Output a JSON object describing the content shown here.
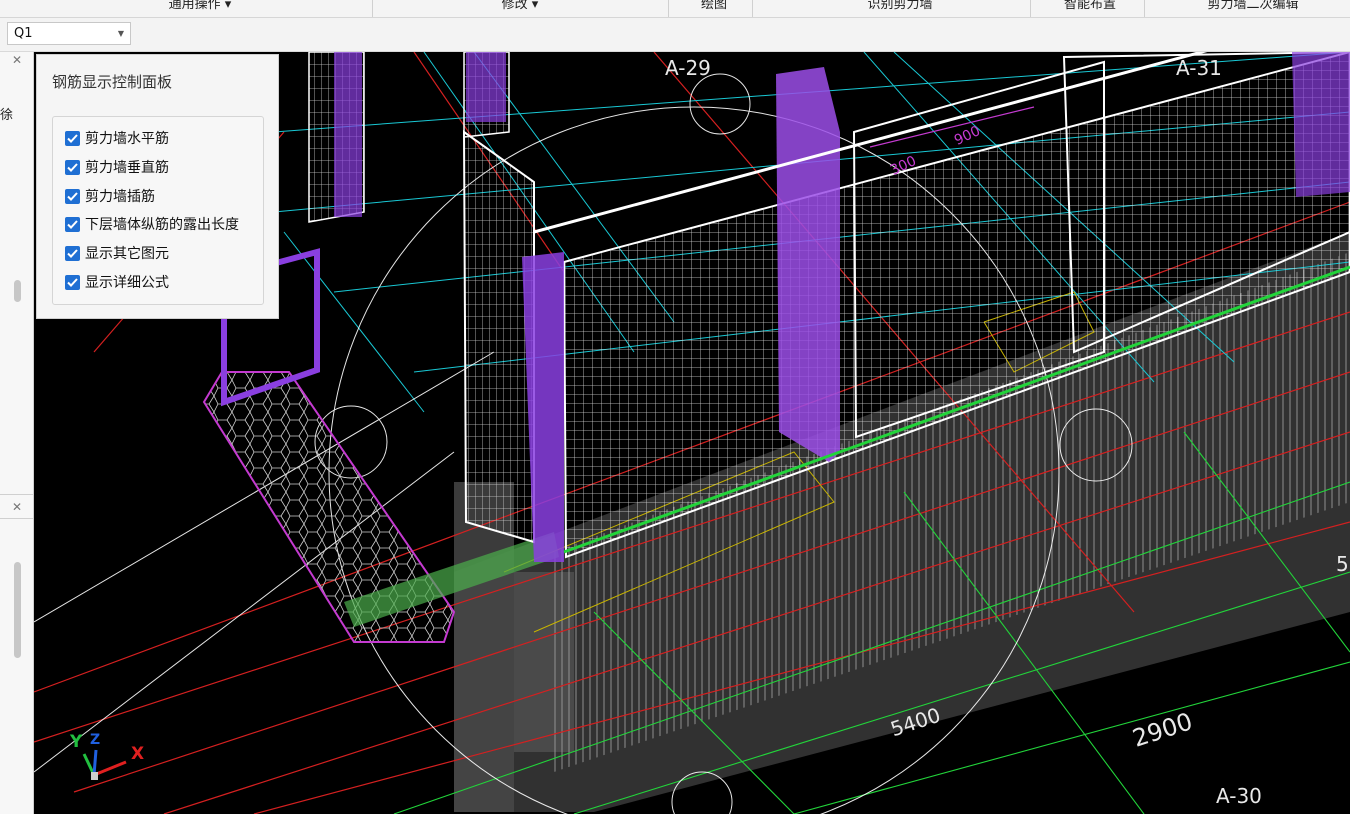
{
  "ribbon": {
    "groups": [
      "通用操作 ▾",
      "修改 ▾",
      "绘图",
      "识别剪力墙",
      "智能布置",
      "剪力墙二次编辑"
    ]
  },
  "floor_select": {
    "value": "Q1"
  },
  "left_panel": {
    "title_fragment": "徐",
    "close_glyph": "✕"
  },
  "control_panel": {
    "title": "钢筋显示控制面板",
    "options": [
      {
        "label": "剪力墙水平筋",
        "checked": true
      },
      {
        "label": "剪力墙垂直筋",
        "checked": true
      },
      {
        "label": "剪力墙插筋",
        "checked": true
      },
      {
        "label": "下层墙体纵筋的露出长度",
        "checked": true
      },
      {
        "label": "显示其它图元",
        "checked": true
      },
      {
        "label": "显示详细公式",
        "checked": true
      }
    ]
  },
  "viewport_labels": {
    "axis_a29": "A-29",
    "axis_a31": "A-31",
    "axis_a30": "A-30",
    "dim_5400": "5400",
    "dim_2900": "2900",
    "dim_900": "900",
    "dim_300": "300",
    "dim_partial": "5"
  },
  "axis_gizmo": {
    "x": "X",
    "y": "Y",
    "z": "Z"
  },
  "colors": {
    "cyan": "#19c8d4",
    "red": "#d42020",
    "green": "#22d43a",
    "purple": "#8a3fe0",
    "magenta": "#c43ad0",
    "checkbox": "#1f6fd3"
  }
}
